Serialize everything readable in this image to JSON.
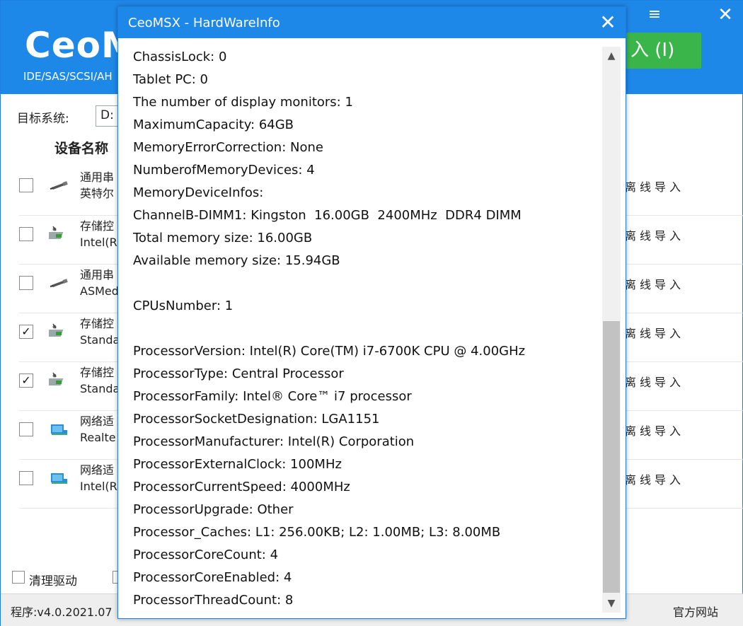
{
  "app": {
    "logo": "CeoM",
    "subtitle": "IDE/SAS/SCSI/AH",
    "menu_glyph": "≡",
    "close_glyph": "✕",
    "import_button": "入 (I)",
    "target_label": "目标系统:",
    "target_value": "D:",
    "column_header": "设备名称",
    "right_header_mark": "I",
    "devices": [
      {
        "line1": "通用串",
        "line2": "英特尔",
        "checked": false,
        "icon": "usb-icon",
        "action": "离线导入"
      },
      {
        "line1": "存储控",
        "line2": "Intel(R",
        "checked": false,
        "icon": "storage-controller-icon",
        "action": "离线导入"
      },
      {
        "line1": "通用串",
        "line2": "ASMed",
        "checked": false,
        "icon": "usb-icon",
        "action": "离线导入"
      },
      {
        "line1": "存储控",
        "line2": "Standa",
        "checked": true,
        "icon": "storage-controller-icon",
        "action": "离线导入"
      },
      {
        "line1": "存储控",
        "line2": "Standa",
        "checked": true,
        "icon": "storage-controller-icon",
        "action": "离线导入"
      },
      {
        "line1": "网络适",
        "line2": "Realte",
        "checked": false,
        "icon": "network-adapter-icon",
        "action": "离线导入"
      },
      {
        "line1": "网络适",
        "line2": "Intel(R",
        "checked": false,
        "icon": "network-adapter-icon",
        "action": "离线导入"
      }
    ],
    "clean_driver_label": "清理驱动",
    "version": "程序:v4.0.2021.07",
    "website_link": "官方网站"
  },
  "dialog": {
    "title": "CeoMSX - HardWareInfo",
    "close_glyph": "✕",
    "lines": [
      "ChassisLock: 0",
      "Tablet PC: 0",
      "The number of display monitors: 1",
      "MaximumCapacity: 64GB",
      "MemoryErrorCorrection: None",
      "NumberofMemoryDevices: 4",
      "MemoryDeviceInfos:",
      "ChannelB-DIMM1: Kingston  16.00GB  2400MHz  DDR4 DIMM",
      "Total memory size: 16.00GB",
      "Available memory size: 15.94GB",
      "",
      "CPUsNumber: 1",
      "",
      "ProcessorVersion: Intel(R) Core(TM) i7-6700K CPU @ 4.00GHz",
      "ProcessorType: Central Processor",
      "ProcessorFamily: Intel® Core™ i7 processor",
      "ProcessorSocketDesignation: LGA1151",
      "ProcessorManufacturer: Intel(R) Corporation",
      "ProcessorExternalClock: 100MHz",
      "ProcessorCurrentSpeed: 4000MHz",
      "ProcessorUpgrade: Other",
      "Processor_Caches: L1: 256.00KB; L2: 1.00MB; L3: 8.00MB",
      "ProcessorCoreCount: 4",
      "ProcessorCoreEnabled: 4",
      "ProcessorThreadCount: 8"
    ],
    "scroll_position": 0.5
  }
}
